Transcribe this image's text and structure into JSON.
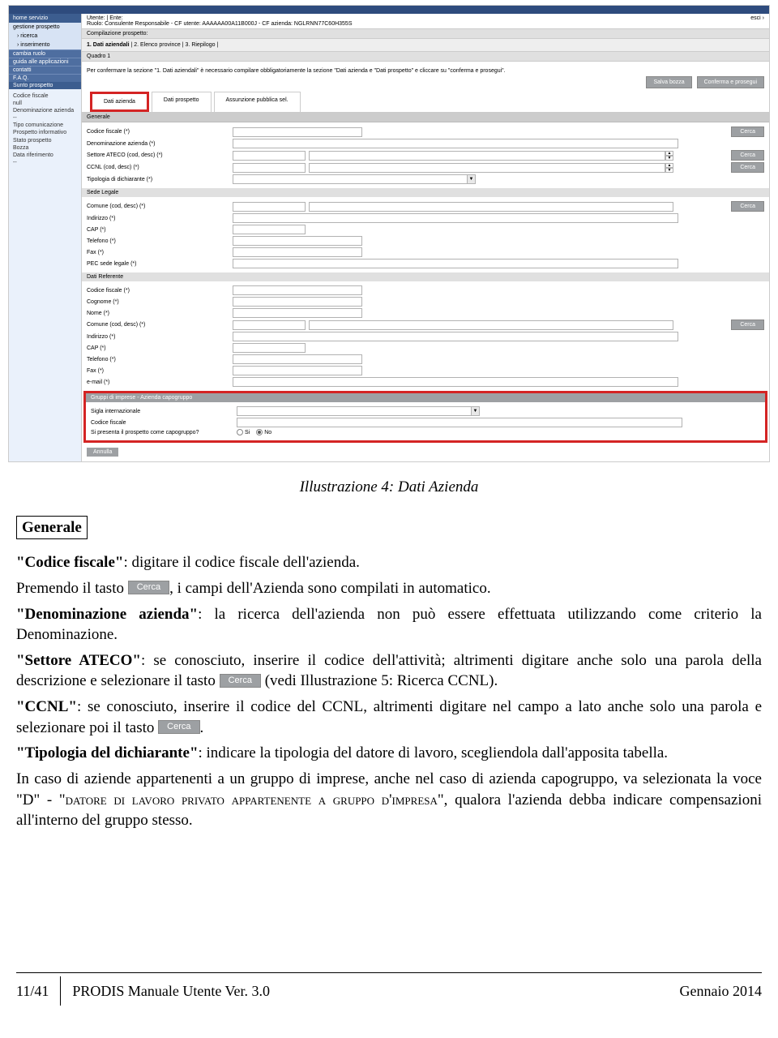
{
  "nav": {
    "home": "home servizio",
    "gestione": "gestione prospetto",
    "ricerca": "› ricerca",
    "inserimento": "› inserimento",
    "cambia": "cambia ruolo",
    "guida": "guida alle applicazioni",
    "contatti": "contatti",
    "faq": "F.A.Q.",
    "sunto": "Sunto prospetto",
    "info": "Codice fiscale\nnull\nDenominazione azienda\n--\nTipo comunicazione\nProspetto informativo\nStato prospetto\nBozza\nData riferimento\n--"
  },
  "user": {
    "line": "Utente: | Ente:\nRuolo: Consulente Responsabile - CF utente: AAAAAA00A11B000J - CF azienda: NGLRNN77C60H355S",
    "esci": "esci ›"
  },
  "sections": {
    "compilazione": "Compilazione prospetto:",
    "steps_active": "1. Dati aziendali",
    "steps_rest": " | 2. Elenco province | 3. Riepilogo |",
    "quadro": "Quadro 1",
    "notice": "Per confermare la sezione \"1. Dati aziendali\" è necessario compilare obbligatoriamente la sezione \"Dati azienda e \"Dati prospetto\" e cliccare su \"conferma e prosegui\".",
    "btn_salva": "Salva bozza",
    "btn_conferma": "Conferma e prosegui",
    "tab1": "Dati azienda",
    "tab2": "Dati prospetto",
    "tab3": "Assunzione pubblica sel.",
    "generale": "Generale",
    "sede": "Sede Legale",
    "referente": "Dati Referente",
    "gruppi": "Gruppi di imprese - Azienda capogruppo",
    "annulla": "Annulla",
    "cerca": "Cerca"
  },
  "labels": {
    "cf": "Codice fiscale (*)",
    "denom": "Denominazione azienda (*)",
    "ateco": "Settore ATECO (cod, desc) (*)",
    "ccnl": "CCNL (cod, desc) (*)",
    "tipologia": "Tipologia di dichiarante (*)",
    "comune": "Comune (cod, desc) (*)",
    "indirizzo": "Indirizzo (*)",
    "cap": "CAP (*)",
    "telefono": "Telefono (*)",
    "fax": "Fax (*)",
    "pec": "PEC sede legale (*)",
    "cognome": "Cognome (*)",
    "nome": "Nome (*)",
    "email": "e-mail (*)",
    "sigla": "Sigla internazionale",
    "codfisc2": "Codice fiscale",
    "capogruppo": "Si presenta il prospetto come capogruppo?",
    "si": "Si",
    "no": "No"
  },
  "doc": {
    "caption": "Illustrazione 4: Dati Azienda",
    "heading": "Generale",
    "p1a": "\"Codice fiscale\"",
    "p1b": ": digitare il codice fiscale dell'azienda.",
    "p2a": "Premendo il tasto ",
    "p2b": ", i campi dell'Azienda sono compilati in automatico.",
    "p3a": "\"Denominazione azienda\"",
    "p3b": ": la ricerca dell'azienda non può essere effettuata utilizzando come criterio la Denominazione.",
    "p4a": "\"Settore ATECO\"",
    "p4b": ": se conosciuto, inserire il codice dell'attività; altrimenti digitare anche solo una parola della descrizione e selezionare il tasto ",
    "p4c": " (vedi Illustrazione 5: Ricerca CCNL).",
    "p5a": "\"CCNL\"",
    "p5b": ": se conosciuto, inserire il codice del CCNL, altrimenti digitare nel campo a lato anche solo una parola e selezionare poi il tasto ",
    "p5c": ".",
    "p6a": "\"Tipologia del dichiarante\"",
    "p6b": ": indicare la tipologia del datore di lavoro, scegliendola dall'apposita tabella.",
    "p7a": "In caso di aziende appartenenti a un gruppo di imprese, anche nel caso di azienda capogruppo, va selezionata la voce \"D\" - \"",
    "p7b": "datore di lavoro privato appartenente a gruppo d'impresa",
    "p7c": "\", qualora l'azienda debba indicare compensazioni all'interno del gruppo stesso.",
    "cerca": "Cerca"
  },
  "footer": {
    "page": "11/41",
    "title": "PRODIS Manuale Utente  Ver. 3.0",
    "date": "Gennaio 2014"
  }
}
